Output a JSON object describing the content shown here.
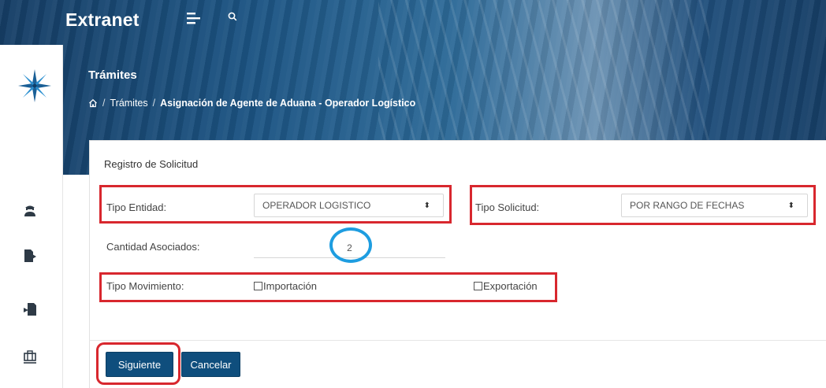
{
  "header": {
    "brand": "Extranet",
    "menu_icon": "menu-toggle-icon",
    "search_icon": "search-icon"
  },
  "page": {
    "heading": "Trámites",
    "breadcrumb": {
      "home_icon": "home-icon",
      "sep1": "/",
      "item1": "Trámites",
      "sep2": "/",
      "current": "Asignación de Agente de Aduana - Operador Logístico"
    }
  },
  "sidebar": {
    "logo": "compass-star-logo",
    "items": [
      {
        "icon": "customs-agent-icon"
      },
      {
        "icon": "export-document-icon"
      },
      {
        "icon": "import-document-icon"
      },
      {
        "icon": "cargo-luggage-icon"
      }
    ]
  },
  "form": {
    "title": "Registro de Solicitud",
    "tipo_entidad": {
      "label": "Tipo Entidad:",
      "value": "OPERADOR LOGISTICO"
    },
    "tipo_solicitud": {
      "label": "Tipo Solicitud:",
      "value": "POR RANGO DE FECHAS"
    },
    "cantidad_asociados": {
      "label": "Cantidad Asociados:",
      "value": "2"
    },
    "tipo_movimiento": {
      "label": "Tipo Movimiento:",
      "option1": "Importación",
      "option2": "Exportación"
    },
    "buttons": {
      "next": "Siguiente",
      "cancel": "Cancelar"
    }
  },
  "colors": {
    "highlight_red": "#d8272e",
    "highlight_blue": "#1e9de0",
    "button_blue": "#0f4e7d"
  }
}
